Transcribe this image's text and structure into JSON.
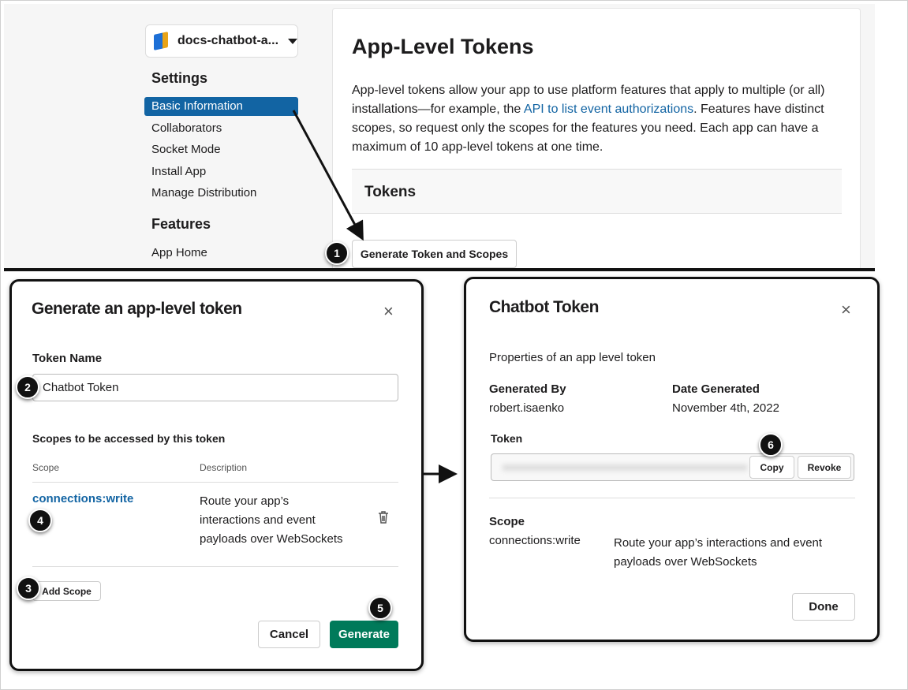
{
  "sidebar": {
    "app_name": "docs-chatbot-a...",
    "settings_heading": "Settings",
    "items": [
      "Basic Information",
      "Collaborators",
      "Socket Mode",
      "Install App",
      "Manage Distribution"
    ],
    "features_heading": "Features",
    "feature_items": [
      "App Home"
    ]
  },
  "main": {
    "title": "App-Level Tokens",
    "para_1": "App-level tokens allow your app to use platform features that apply to multiple (or all) installations—for example, the ",
    "link": "API to list event authorizations",
    "para_2": ". Features have distinct scopes, so request only the scopes for the features you need. Each app can have a maximum of 10 app-level tokens at one time.",
    "tokens_heading": "Tokens",
    "generate_button": "Generate Token and Scopes"
  },
  "badges": [
    "1",
    "2",
    "3",
    "4",
    "5",
    "6"
  ],
  "generate_modal": {
    "title": "Generate an app-level token",
    "close": "×",
    "token_name_label": "Token Name",
    "token_name_value": "Chatbot Token",
    "scopes_heading": "Scopes to be accessed by this token",
    "col_scope": "Scope",
    "col_description": "Description",
    "scope": "connections:write",
    "description_lines": [
      "Route your app’s",
      "interactions and event",
      "payloads over WebSockets"
    ],
    "add_scope": "Add Scope",
    "cancel": "Cancel",
    "generate": "Generate"
  },
  "token_modal": {
    "title": "Chatbot Token",
    "close": "×",
    "subtitle": "Properties of an app level token",
    "generated_by_label": "Generated By",
    "generated_by": "robert.isaenko",
    "date_label": "Date Generated",
    "date": "November 4th, 2022",
    "token_label": "Token",
    "copy": "Copy",
    "revoke": "Revoke",
    "scope_label": "Scope",
    "scope": "connections:write",
    "description_lines": [
      "Route your app’s interactions and event",
      "payloads over WebSockets"
    ],
    "done": "Done"
  },
  "colors": {
    "accent": "#1264a3",
    "green": "#007a5a"
  }
}
